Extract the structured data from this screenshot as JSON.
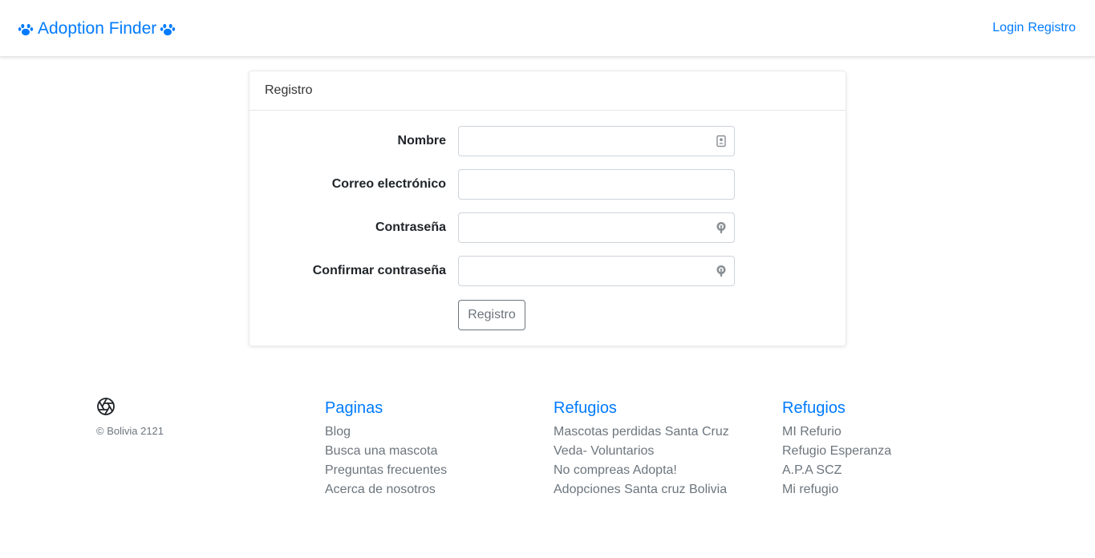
{
  "navbar": {
    "brand": "Adoption Finder",
    "brand_icon": "paw-icon",
    "links": [
      "Login",
      "Registro"
    ]
  },
  "card": {
    "header": "Registro",
    "fields": [
      {
        "label": "Nombre",
        "value": "",
        "icon": "contact-card-icon"
      },
      {
        "label": "Correo electrónico",
        "value": "",
        "icon": ""
      },
      {
        "label": "Contraseña",
        "value": "",
        "icon": "password-key-icon"
      },
      {
        "label": "Confirmar contraseña",
        "value": "",
        "icon": "password-key-icon"
      }
    ],
    "submit_label": "Registro"
  },
  "footer": {
    "logo_icon": "aperture-icon",
    "copyright": "© Bolivia 2121",
    "columns": [
      {
        "title": "Paginas",
        "items": [
          "Blog",
          "Busca una mascota",
          "Preguntas frecuentes",
          "Acerca de nosotros"
        ]
      },
      {
        "title": "Refugios",
        "items": [
          "Mascotas perdidas Santa Cruz",
          "Veda- Voluntarios",
          "No compreas Adopta!",
          "Adopciones Santa cruz Bolivia"
        ]
      },
      {
        "title": "Refugios",
        "items": [
          "MI Refurio",
          "Refugio Esperanza",
          "A.P.A SCZ",
          "Mi refugio"
        ]
      }
    ]
  },
  "colors": {
    "accent": "#007bff",
    "muted": "#6c757d",
    "border": "#ced4da"
  }
}
